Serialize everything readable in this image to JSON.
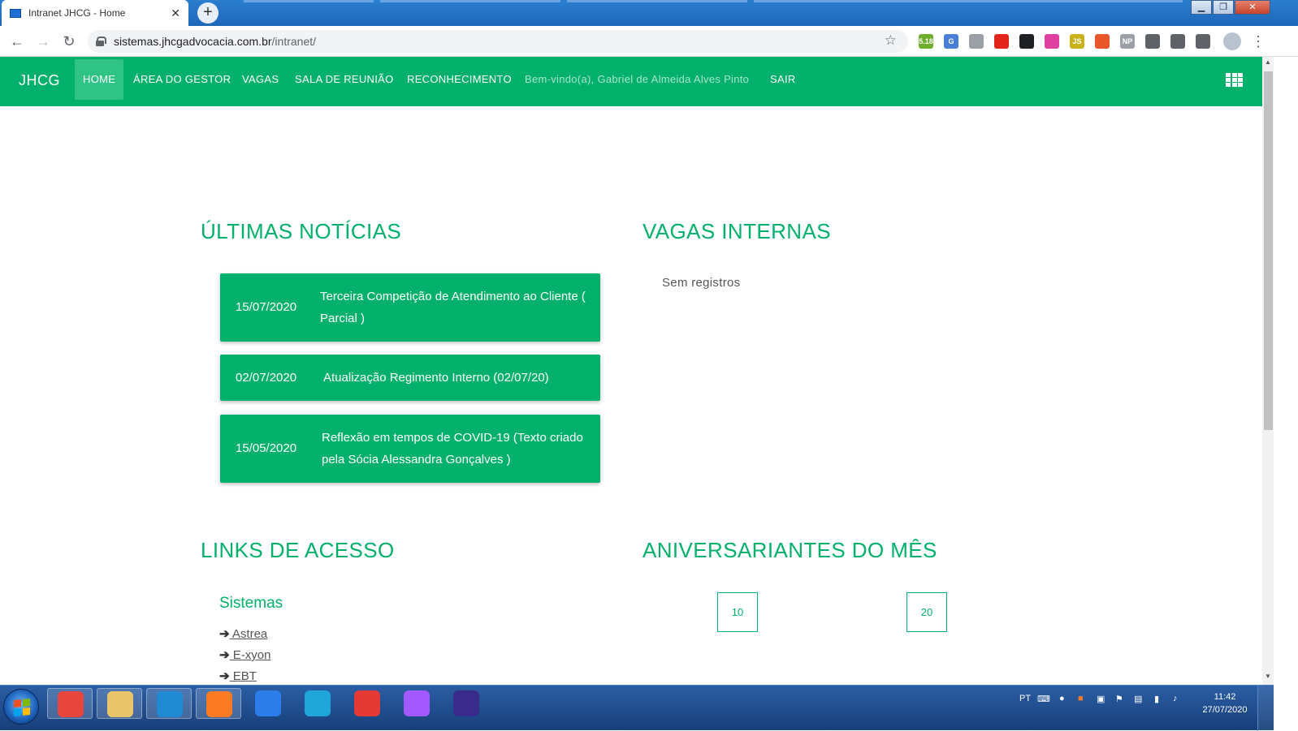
{
  "browser": {
    "tab_title": "Intranet JHCG - Home",
    "new_tab": "+",
    "url_host": "sistemas.jhcgadvocacia.com.br",
    "url_path": "/intranet/",
    "extensions": [
      {
        "name": "android-ext-icon",
        "label": "5.18",
        "color": "#6fae2d"
      },
      {
        "name": "translate-ext-icon",
        "label": "G",
        "color": "#4a7fd8"
      },
      {
        "name": "compass-ext-icon",
        "label": "",
        "color": "#9aa0a6"
      },
      {
        "name": "adblock-ext-icon",
        "label": "",
        "color": "#e3261b"
      },
      {
        "name": "mask-ext-icon",
        "label": "",
        "color": "#202124"
      },
      {
        "name": "colorpicker-ext-icon",
        "label": "",
        "color": "#e040a0"
      },
      {
        "name": "js-ext-icon",
        "label": "JS",
        "color": "#c9b21a"
      },
      {
        "name": "fire-ext-icon",
        "label": "",
        "color": "#e8562a"
      },
      {
        "name": "np-ext-icon",
        "label": "NP",
        "color": "#9aa0a6"
      },
      {
        "name": "reader-ext-icon",
        "label": "",
        "color": "#5f6368"
      },
      {
        "name": "puzzle-ext-icon",
        "label": "",
        "color": "#5f6368"
      },
      {
        "name": "playlist-ext-icon",
        "label": "",
        "color": "#5f6368"
      }
    ]
  },
  "nav": {
    "brand": "JHCG",
    "items": [
      "HOME",
      "ÁREA DO GESTOR",
      "VAGAS",
      "SALA DE REUNIÃO",
      "RECONHECIMENTO"
    ],
    "welcome": "Bem-vindo(a), Gabriel de Almeida Alves Pinto",
    "logout": "SAIR",
    "accent": "#00b06b"
  },
  "news": {
    "title": "ÚLTIMAS NOTÍCIAS",
    "items": [
      {
        "date": "15/07/2020",
        "text": "Terceira Competição de Atendimento ao Cliente ( Parcial )"
      },
      {
        "date": "02/07/2020",
        "text": "Atualização Regimento Interno (02/07/20)"
      },
      {
        "date": "15/05/2020",
        "text": "Reflexão em tempos de COVID-19 (Texto criado pela Sócia Alessandra Gonçalves )"
      }
    ]
  },
  "vacancies": {
    "title": "VAGAS INTERNAS",
    "empty": "Sem registros"
  },
  "links": {
    "title": "LINKS DE ACESSO",
    "group": "Sistemas",
    "items": [
      " Astrea",
      " E-xyon",
      " EBT"
    ]
  },
  "birthdays": {
    "title": "ANIVERSARIANTES DO MÊS",
    "days": [
      "10",
      "20"
    ]
  },
  "taskbar": {
    "apps": [
      {
        "name": "chrome-taskbar-icon",
        "color": "#e8453c",
        "pinned": true
      },
      {
        "name": "explorer-taskbar-icon",
        "color": "#e9c46a",
        "pinned": true
      },
      {
        "name": "vscode-taskbar-icon",
        "color": "#1f8ad2",
        "pinned": true
      },
      {
        "name": "xampp-taskbar-icon",
        "color": "#fb7a24",
        "pinned": true
      },
      {
        "name": "wps-taskbar-icon",
        "color": "#2b7de9",
        "pinned": false
      },
      {
        "name": "edge-taskbar-icon",
        "color": "#1fa5d8",
        "pinned": false
      },
      {
        "name": "anydesk-taskbar-icon",
        "color": "#e53935",
        "pinned": false
      },
      {
        "name": "figma-taskbar-icon",
        "color": "#a259ff",
        "pinned": false
      },
      {
        "name": "music-taskbar-icon",
        "color": "#3a2a8c",
        "pinned": false
      }
    ],
    "language": "PT",
    "time": "11:42",
    "date": "27/07/2020"
  }
}
